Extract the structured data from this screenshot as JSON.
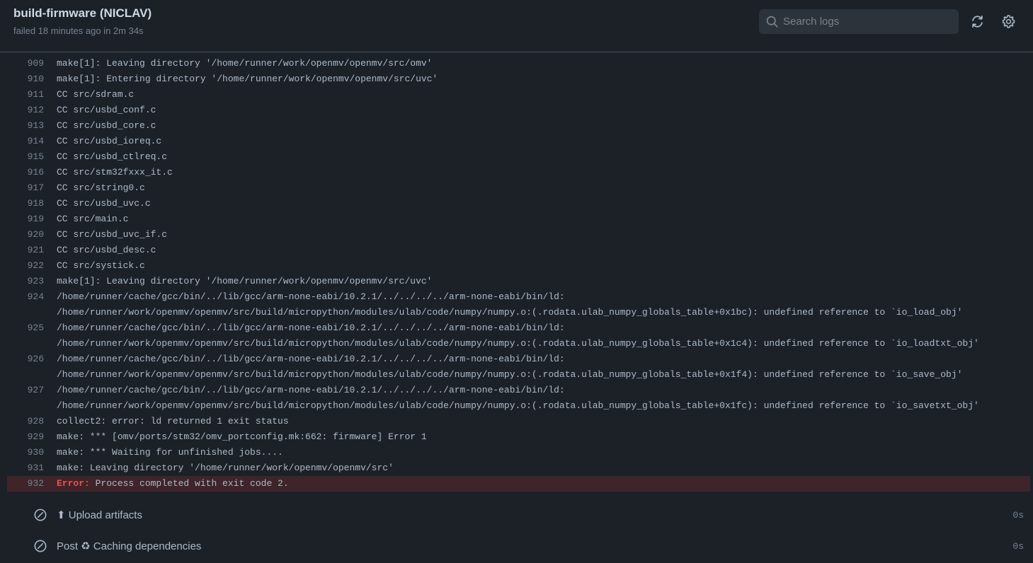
{
  "header": {
    "title": "build-firmware (NICLAV)",
    "subtitle": "failed 18 minutes ago in 2m 34s",
    "search_placeholder": "Search logs",
    "icons": [
      "search-icon",
      "refresh-icon",
      "gear-icon"
    ]
  },
  "log": {
    "lines": [
      {
        "num": "909",
        "text": "make[1]: Leaving directory '/home/runner/work/openmv/openmv/src/omv'"
      },
      {
        "num": "910",
        "text": "make[1]: Entering directory '/home/runner/work/openmv/openmv/src/uvc'"
      },
      {
        "num": "911",
        "text": "CC src/sdram.c"
      },
      {
        "num": "912",
        "text": "CC src/usbd_conf.c"
      },
      {
        "num": "913",
        "text": "CC src/usbd_core.c"
      },
      {
        "num": "914",
        "text": "CC src/usbd_ioreq.c"
      },
      {
        "num": "915",
        "text": "CC src/usbd_ctlreq.c"
      },
      {
        "num": "916",
        "text": "CC src/stm32fxxx_it.c"
      },
      {
        "num": "917",
        "text": "CC src/string0.c"
      },
      {
        "num": "918",
        "text": "CC src/usbd_uvc.c"
      },
      {
        "num": "919",
        "text": "CC src/main.c"
      },
      {
        "num": "920",
        "text": "CC src/usbd_uvc_if.c"
      },
      {
        "num": "921",
        "text": "CC src/usbd_desc.c"
      },
      {
        "num": "922",
        "text": "CC src/systick.c"
      },
      {
        "num": "923",
        "text": "make[1]: Leaving directory '/home/runner/work/openmv/openmv/src/uvc'"
      },
      {
        "num": "924",
        "text": "/home/runner/cache/gcc/bin/../lib/gcc/arm-none-eabi/10.2.1/../../../../arm-none-eabi/bin/ld:\n/home/runner/work/openmv/openmv/src/build/micropython/modules/ulab/code/numpy/numpy.o:(.rodata.ulab_numpy_globals_table+0x1bc): undefined reference to `io_load_obj'"
      },
      {
        "num": "925",
        "text": "/home/runner/cache/gcc/bin/../lib/gcc/arm-none-eabi/10.2.1/../../../../arm-none-eabi/bin/ld:\n/home/runner/work/openmv/openmv/src/build/micropython/modules/ulab/code/numpy/numpy.o:(.rodata.ulab_numpy_globals_table+0x1c4): undefined reference to `io_loadtxt_obj'"
      },
      {
        "num": "926",
        "text": "/home/runner/cache/gcc/bin/../lib/gcc/arm-none-eabi/10.2.1/../../../../arm-none-eabi/bin/ld:\n/home/runner/work/openmv/openmv/src/build/micropython/modules/ulab/code/numpy/numpy.o:(.rodata.ulab_numpy_globals_table+0x1f4): undefined reference to `io_save_obj'"
      },
      {
        "num": "927",
        "text": "/home/runner/cache/gcc/bin/../lib/gcc/arm-none-eabi/10.2.1/../../../../arm-none-eabi/bin/ld:\n/home/runner/work/openmv/openmv/src/build/micropython/modules/ulab/code/numpy/numpy.o:(.rodata.ulab_numpy_globals_table+0x1fc): undefined reference to `io_savetxt_obj'"
      },
      {
        "num": "928",
        "text": "collect2: error: ld returned 1 exit status"
      },
      {
        "num": "929",
        "text": "make: *** [omv/ports/stm32/omv_portconfig.mk:662: firmware] Error 1"
      },
      {
        "num": "930",
        "text": "make: *** Waiting for unfinished jobs...."
      },
      {
        "num": "931",
        "text": "make: Leaving directory '/home/runner/work/openmv/openmv/src'"
      }
    ],
    "error_line": {
      "num": "932",
      "label": "Error:",
      "text": " Process completed with exit code 2."
    },
    "error_color": "#e5534b"
  },
  "steps": [
    {
      "label": "⬆ Upload artifacts",
      "time": "0s",
      "icon": "skipped-icon"
    },
    {
      "label": "Post ♻ Caching dependencies",
      "time": "0s",
      "icon": "skipped-icon"
    }
  ]
}
